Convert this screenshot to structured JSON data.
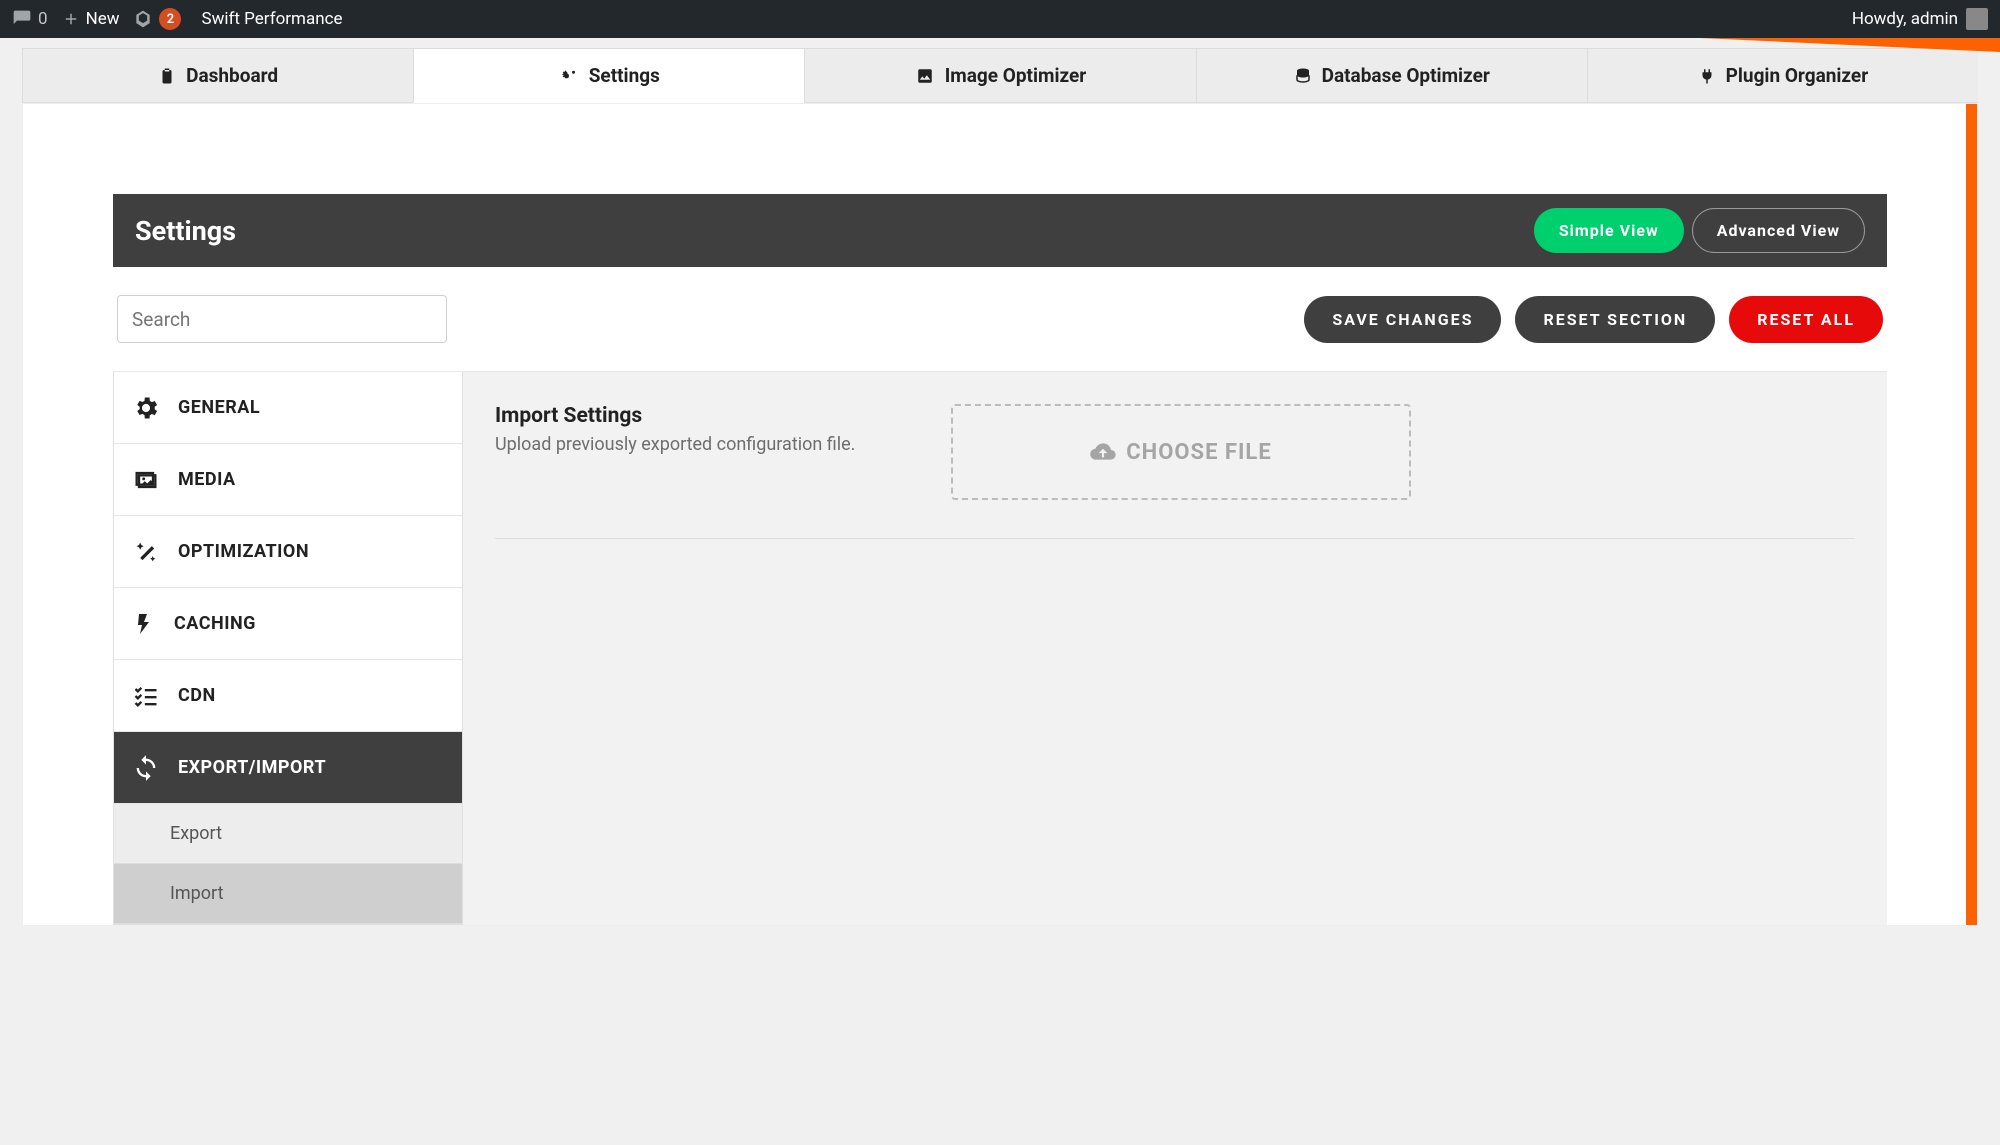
{
  "admin_bar": {
    "comments": "0",
    "new": "New",
    "yoast_badge": "2",
    "breadcrumb": "Swift Performance",
    "howdy": "Howdy, admin"
  },
  "tabs": [
    {
      "label": "Dashboard",
      "icon": "clipboard"
    },
    {
      "label": "Settings",
      "icon": "cogs"
    },
    {
      "label": "Image Optimizer",
      "icon": "image"
    },
    {
      "label": "Database Optimizer",
      "icon": "database"
    },
    {
      "label": "Plugin Organizer",
      "icon": "plug"
    }
  ],
  "panel": {
    "title": "Settings",
    "simple": "Simple View",
    "advanced": "Advanced View"
  },
  "search": {
    "placeholder": "Search"
  },
  "actions": {
    "save": "SAVE CHANGES",
    "reset_section": "RESET SECTION",
    "reset_all": "RESET ALL"
  },
  "sidebar": [
    {
      "label": "GENERAL",
      "icon": "gear"
    },
    {
      "label": "MEDIA",
      "icon": "image"
    },
    {
      "label": "OPTIMIZATION",
      "icon": "wand"
    },
    {
      "label": "CACHING",
      "icon": "bolt"
    },
    {
      "label": "CDN",
      "icon": "list-check"
    },
    {
      "label": "EXPORT/IMPORT",
      "icon": "sync",
      "active": true
    }
  ],
  "sidebar_sub": [
    {
      "label": "Export"
    },
    {
      "label": "Import",
      "selected": true
    }
  ],
  "import": {
    "title": "Import Settings",
    "desc": "Upload previously exported configuration file.",
    "button": "CHOOSE FILE"
  }
}
